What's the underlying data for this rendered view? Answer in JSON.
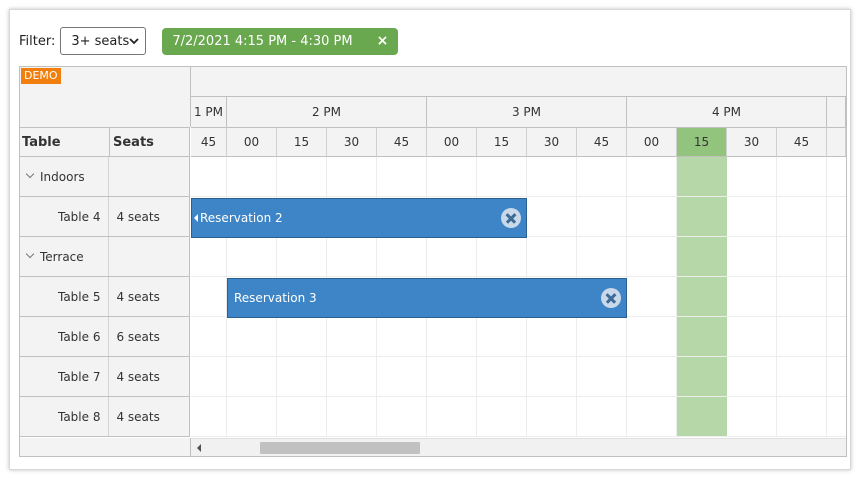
{
  "toolbar": {
    "filter_label": "Filter:",
    "filter_value": "3+ seats",
    "range_chip": "7/2/2021 4:15 PM - 4:30 PM",
    "range_chip_close": "×"
  },
  "scheduler": {
    "demo_badge": "DEMO",
    "columns": {
      "table": "Table",
      "seats": "Seats"
    },
    "hours": [
      "1 PM",
      "2 PM",
      "3 PM",
      "4 PM"
    ],
    "minutes": [
      "45",
      "00",
      "15",
      "30",
      "45",
      "00",
      "15",
      "30",
      "45",
      "00",
      "15",
      "30",
      "45"
    ],
    "rows": [
      {
        "type": "group",
        "label": "Indoors",
        "seats": ""
      },
      {
        "type": "child",
        "label": "Table 4",
        "seats": "4 seats"
      },
      {
        "type": "group",
        "label": "Terrace",
        "seats": ""
      },
      {
        "type": "child",
        "label": "Table 5",
        "seats": "4 seats"
      },
      {
        "type": "child",
        "label": "Table 6",
        "seats": "6 seats"
      },
      {
        "type": "child",
        "label": "Table 7",
        "seats": "4 seats"
      },
      {
        "type": "child",
        "label": "Table 8",
        "seats": "4 seats"
      }
    ],
    "events": [
      {
        "text": "Reservation 2"
      },
      {
        "text": "Reservation 3"
      }
    ],
    "colors": {
      "event": "#3d85c6",
      "highlight_header": "#93c47d",
      "highlight_column": "#b6d7a8",
      "chip": "#6aa84f",
      "demo": "#f07f0e"
    }
  }
}
